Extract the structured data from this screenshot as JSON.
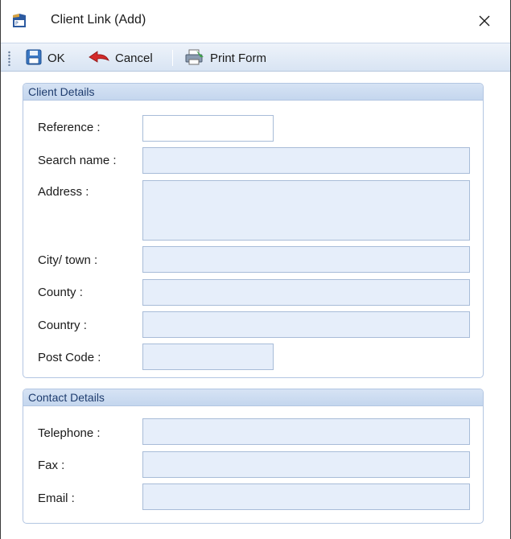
{
  "window": {
    "title": "Client Link (Add)",
    "app_icon": "app-icon",
    "close_icon": "close-icon"
  },
  "toolbar": {
    "ok_label": "OK",
    "cancel_label": "Cancel",
    "print_label": "Print Form",
    "icons": {
      "ok": "save-disk-icon",
      "cancel": "back-arrow-icon",
      "print": "print-form-icon"
    }
  },
  "client_details": {
    "title": "Client Details",
    "fields": {
      "reference": {
        "label": "Reference :",
        "value": ""
      },
      "search_name": {
        "label": "Search name :",
        "value": ""
      },
      "address": {
        "label": "Address :",
        "value": ""
      },
      "city": {
        "label": "City/ town :",
        "value": ""
      },
      "county": {
        "label": "County :",
        "value": ""
      },
      "country": {
        "label": "Country :",
        "value": ""
      },
      "post_code": {
        "label": "Post Code :",
        "value": ""
      }
    }
  },
  "contact_details": {
    "title": "Contact Details",
    "fields": {
      "telephone": {
        "label": "Telephone :",
        "value": ""
      },
      "fax": {
        "label": "Fax :",
        "value": ""
      },
      "email": {
        "label": "Email :",
        "value": ""
      }
    }
  },
  "colors": {
    "toolbar_bg": "#d8e4f3",
    "group_header_bg": "#c4d6ee",
    "group_title_text": "#1e3c6e",
    "readonly_field_bg": "#e6eefa",
    "editable_field_bg": "#ffffff",
    "field_border": "#a8bcd8"
  }
}
